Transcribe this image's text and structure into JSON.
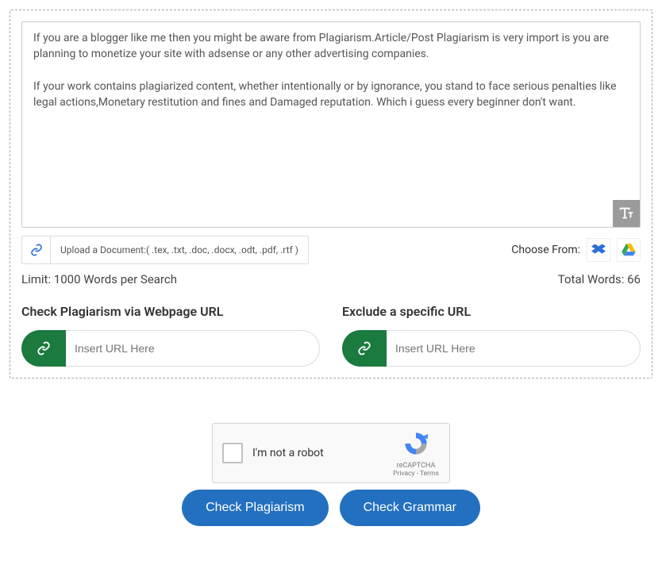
{
  "textarea": {
    "content": "If you are a blogger like me then you might be aware from Plagiarism.Article/Post Plagiarism is very import is you are planning to monetize your site with adsense or any other advertising companies.\n\nIf your work contains plagiarized content, whether intentionally or by ignorance, you stand to face serious penalties like legal actions,Monetary restitution and fines and Damaged reputation. Which i guess every beginner don't want."
  },
  "upload": {
    "label": "Upload a Document:( .tex, .txt, .doc, .docx, .odt, .pdf, .rtf )",
    "choose_label": "Choose From:"
  },
  "stats": {
    "limit": "Limit: 1000 Words per Search",
    "total": "Total Words: 66"
  },
  "url_check": {
    "title": "Check Plagiarism via Webpage URL",
    "placeholder": "Insert URL Here"
  },
  "url_exclude": {
    "title": "Exclude a specific URL",
    "placeholder": "Insert URL Here"
  },
  "captcha": {
    "label": "I'm not a robot",
    "brand": "reCAPTCHA",
    "privacy": "Privacy",
    "terms": "Terms"
  },
  "buttons": {
    "plagiarism": "Check Plagiarism",
    "grammar": "Check Grammar"
  }
}
